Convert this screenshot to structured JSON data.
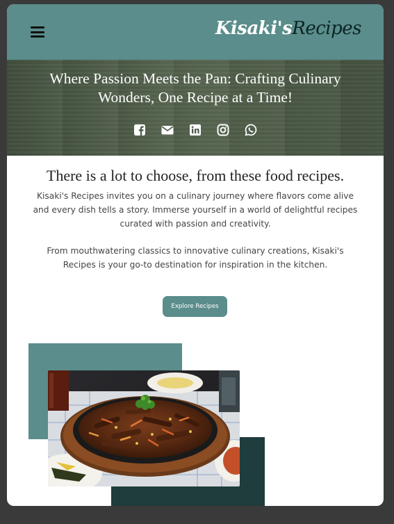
{
  "header": {
    "logo_part1": "Kisaki's",
    "logo_part2": "Recipes",
    "menu_icon": "hamburger-menu-icon",
    "colors": {
      "bar": "#5a8d8b",
      "logo_dark": "#0b2423"
    }
  },
  "hero": {
    "title": "Where Passion Meets the Pan: Crafting Culinary Wonders, One Recipe at a Time!",
    "social_icons": [
      "facebook-icon",
      "email-icon",
      "linkedin-icon",
      "instagram-icon",
      "whatsapp-icon"
    ]
  },
  "intro": {
    "heading": "There is a lot to choose, from these food recipes.",
    "paragraph1": "Kisaki's Recipes invites you on a culinary journey where flavors come alive and every dish tells a story. Immerse yourself in a world of delightful recipes curated with passion and creativity.",
    "paragraph2": "From mouthwatering classics to innovative culinary creations, Kisaki's Recipes is your go-to destination for inspiration in the kitchen.",
    "button_label": "Explore Recipes"
  },
  "accent_colors": {
    "teal": "#5a8d8b",
    "dark_teal": "#1e3d3c"
  }
}
